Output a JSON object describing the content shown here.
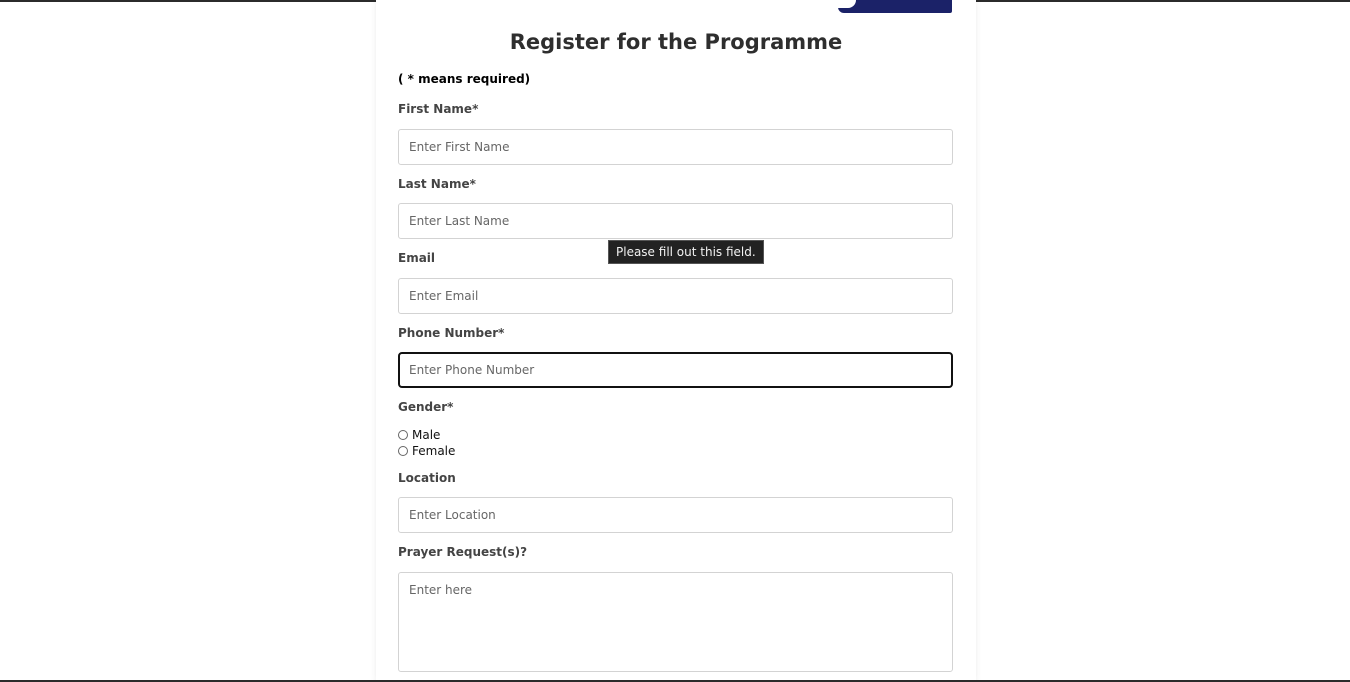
{
  "form": {
    "title": "Register for the Programme",
    "required_note": "( * means required)",
    "first_name": {
      "label": "First Name*",
      "placeholder": "Enter First Name",
      "value": ""
    },
    "last_name": {
      "label": "Last Name*",
      "placeholder": "Enter Last Name",
      "value": ""
    },
    "email": {
      "label": "Email",
      "placeholder": "Enter Email",
      "value": ""
    },
    "phone": {
      "label": "Phone Number*",
      "placeholder": "Enter Phone Number",
      "value": ""
    },
    "gender": {
      "label": "Gender*",
      "options": [
        "Male",
        "Female"
      ]
    },
    "location": {
      "label": "Location",
      "placeholder": "Enter Location",
      "value": ""
    },
    "prayer": {
      "label": "Prayer Request(s)?",
      "placeholder": "Enter here",
      "value": ""
    }
  },
  "tooltip": {
    "text": "Please fill out this field."
  },
  "colors": {
    "banner": "#1b2268",
    "focus_border": "#111111",
    "field_border": "#d3d3d3"
  }
}
